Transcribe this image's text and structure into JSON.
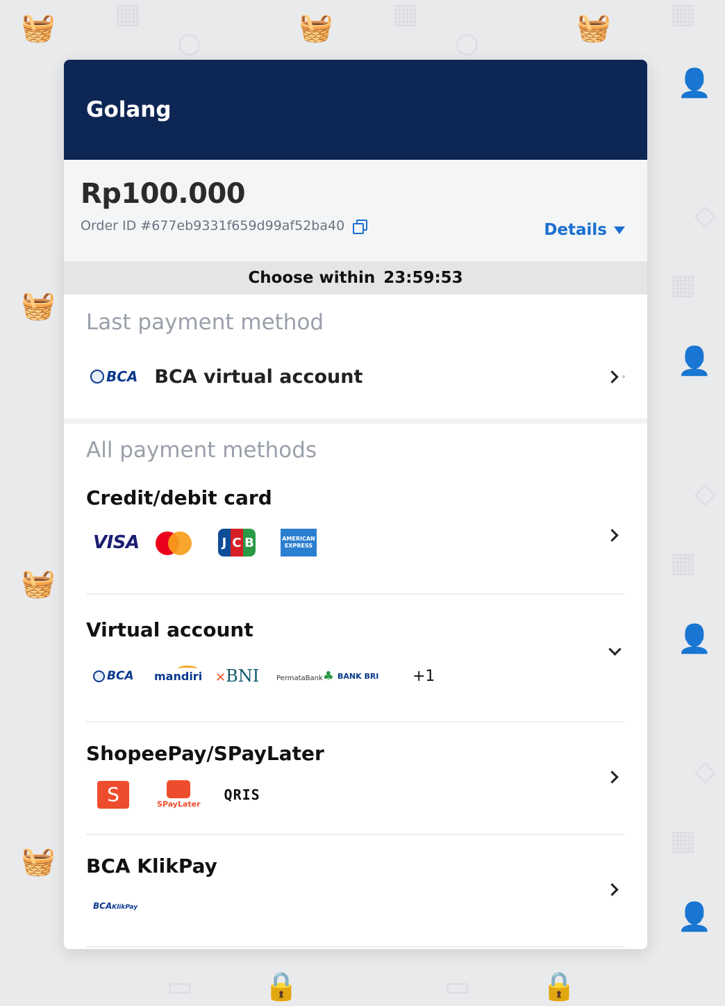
{
  "merchant": {
    "name": "Golang"
  },
  "order": {
    "amount": "Rp100.000",
    "order_id": "Order ID #677eb9331f659d99af52ba40",
    "details_label": "Details"
  },
  "timer": {
    "label": "Choose within",
    "time": "23:59:53"
  },
  "last_payment": {
    "section_title": "Last payment method",
    "method_label": "BCA virtual account",
    "logo_text": "BCA"
  },
  "all_payments": {
    "section_title": "All payment methods",
    "credit_card": {
      "title": "Credit/debit card",
      "logos": {
        "visa": "VISA",
        "jcb_j": "J",
        "jcb_c": "C",
        "jcb_b": "B",
        "amex_1": "AMERICAN",
        "amex_2": "EXPRESS"
      }
    },
    "virtual_account": {
      "title": "Virtual account",
      "logos": {
        "bca": "BCA",
        "mandiri": "mandiri",
        "bni": "BNI",
        "permata": "PermataBank",
        "bri": "BANK BRI"
      },
      "more": "+1"
    },
    "shopeepay": {
      "title": "ShopeePay/SPayLater",
      "logos": {
        "shopee": "S",
        "spaylater": "SPayLater",
        "qris": "QRIS"
      }
    },
    "klikpay": {
      "title": "BCA KlikPay",
      "logos": {
        "bca": "BCA",
        "klikpay": "KlikPay"
      }
    }
  },
  "colors": {
    "header_bg": "#0e2654",
    "accent": "#1a6fd0",
    "page_bg": "#e9eaec"
  }
}
